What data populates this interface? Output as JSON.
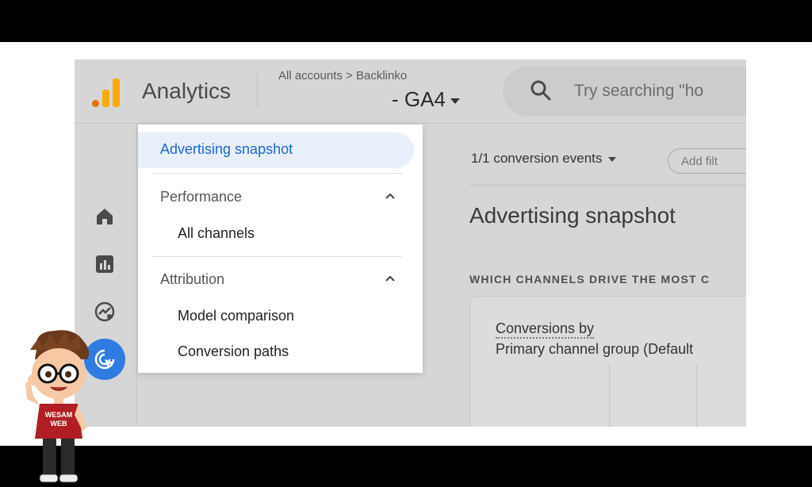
{
  "app": {
    "name": "Analytics",
    "breadcrumb": "All accounts > Backlinko",
    "property": "- GA4",
    "logo_colors": [
      "#e37400",
      "#f9ab00",
      "#f9ab00"
    ]
  },
  "search": {
    "placeholder": "Try searching \"ho",
    "icon": "search-icon"
  },
  "rail": {
    "items": [
      {
        "icon": "home-icon",
        "active": false
      },
      {
        "icon": "reports-icon",
        "active": false
      },
      {
        "icon": "explore-icon",
        "active": false
      },
      {
        "icon": "advertising-icon",
        "active": true
      }
    ],
    "active_color": "#2f7be0"
  },
  "menu": {
    "active_item": "Advertising snapshot",
    "groups": [
      {
        "label": "Performance",
        "items": [
          "All channels"
        ]
      },
      {
        "label": "Attribution",
        "items": [
          "Model comparison",
          "Conversion paths"
        ]
      }
    ],
    "accent": "#1d67cf"
  },
  "content": {
    "conversion_filter": "1/1 conversion events",
    "add_filter": "Add filt",
    "title": "Advertising snapshot",
    "section_heading": "WHICH CHANNELS DRIVE THE MOST C",
    "card": {
      "title_line1": "Conversions by",
      "title_line2": "Primary channel group (Default"
    }
  },
  "mascot": {
    "shirt_text_line1": "WESAM",
    "shirt_text_line2": "WEB"
  }
}
